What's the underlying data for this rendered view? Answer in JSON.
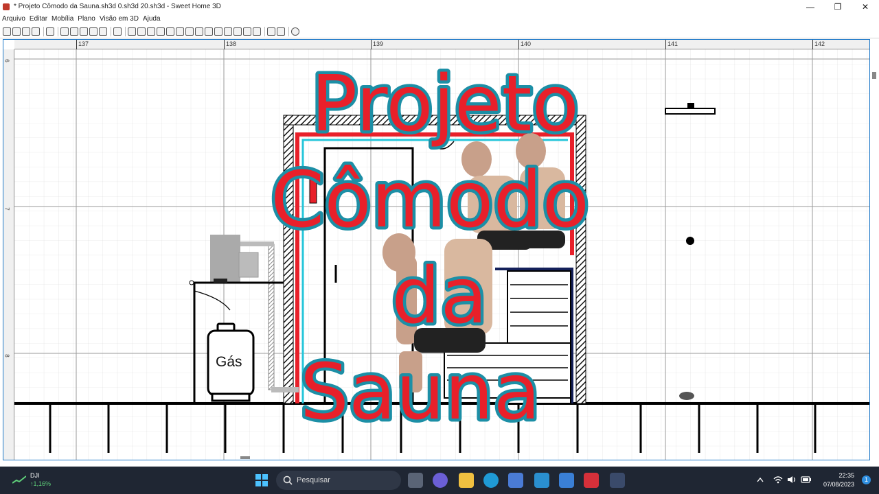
{
  "window": {
    "title": "* Projeto Cômodo da Sauna.sh3d 0.sh3d 20.sh3d - Sweet Home 3D",
    "controls": [
      "—",
      "❐",
      "✕"
    ]
  },
  "menu": [
    "Arquivo",
    "Editar",
    "Mobília",
    "Plano",
    "Visão em 3D",
    "Ajuda"
  ],
  "ruler": {
    "h_labels": [
      "137",
      "138",
      "139",
      "140",
      "141",
      "142"
    ],
    "v_labels": [
      "6",
      "7",
      "8"
    ]
  },
  "plan": {
    "gas_label": "Gás"
  },
  "overlay": {
    "lines": [
      "Projeto",
      "Cômodo",
      "da",
      "Sauna"
    ],
    "fill_color": "#e8202a",
    "stroke_color": "#1c8fa6"
  },
  "taskbar": {
    "widget_name": "DJI",
    "widget_value": "↑1,16%",
    "search_placeholder": "Pesquisar",
    "time": "22:35",
    "date": "07/08/2023",
    "notif_count": "1"
  },
  "icons": {
    "toolbar": [
      "new-icon",
      "open-icon",
      "save-icon",
      "cut-icon",
      "undo-icon",
      "redo-icon",
      "select-icon",
      "pan-icon",
      "wall-icon",
      "room-icon",
      "zoom-in-icon",
      "zoom-out-icon",
      "help-icon"
    ],
    "taskbar": [
      "windows-start-icon",
      "search-icon",
      "task-view-icon",
      "teams-icon",
      "file-explorer-icon",
      "edge-icon",
      "store-icon",
      "l-app-icon",
      "folder-app-icon",
      "red-app-icon",
      "sweet-home-icon"
    ]
  }
}
